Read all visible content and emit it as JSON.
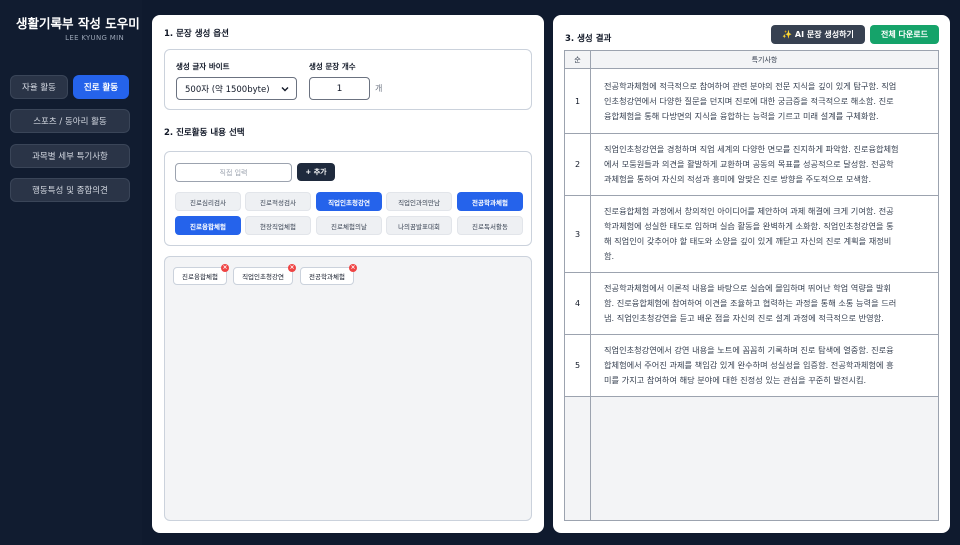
{
  "app": {
    "title": "생활기록부 작성 도우미",
    "author": "LEE KYUNG MIN"
  },
  "sidebar": {
    "tabs": [
      {
        "label": "자율 활동",
        "active": false
      },
      {
        "label": "진로 활동",
        "active": true
      }
    ],
    "items": [
      {
        "label": "스포츠 / 동아리 활동"
      },
      {
        "label": "과목별 세부 특기사항"
      },
      {
        "label": "행동특성 및 종합의견"
      }
    ]
  },
  "options": {
    "section_title": "1. 문장 생성 옵션",
    "byte_label": "생성 글자 바이트",
    "byte_value": "500자 (약 1500byte)",
    "count_label": "생성 문장 개수",
    "count_value": "1",
    "count_unit": "개"
  },
  "activity": {
    "section_title": "2. 진로활동 내용 선택",
    "input_placeholder": "직접 입력",
    "add_label": "+ 추가",
    "chips": [
      {
        "label": "진로심리검사",
        "selected": false
      },
      {
        "label": "진로적성검사",
        "selected": false
      },
      {
        "label": "직업인초청강연",
        "selected": true
      },
      {
        "label": "직업인과의만남",
        "selected": false
      },
      {
        "label": "전공학과체험",
        "selected": true
      },
      {
        "label": "진로융합체험",
        "selected": true
      },
      {
        "label": "현장직업체험",
        "selected": false
      },
      {
        "label": "진로체험의날",
        "selected": false
      },
      {
        "label": "나의꿈발표대회",
        "selected": false
      },
      {
        "label": "진로독서활동",
        "selected": false
      }
    ],
    "selected_items": [
      {
        "label": "진로융합체험"
      },
      {
        "label": "직업인초청강연"
      },
      {
        "label": "전공학과체험"
      }
    ],
    "remove_symbol": "×"
  },
  "results": {
    "section_title": "3. 생성 결과",
    "ai_button_label": "✨ AI 문장 생성하기",
    "download_label": "전체 다운로드",
    "col_num": "순",
    "col_text": "특기사항",
    "rows": [
      {
        "num": "1",
        "lines": [
          "전공학과체험에 적극적으로 참여하여 관련 분야의 전문 지식을 깊이 있게 탐구함. 직업",
          "인초청강연에서 다양한 질문을 던지며 진로에 대한 궁금증을 적극적으로 해소함. 진로",
          "융합체험을 통해 다방면의 지식을 융합하는 능력을 기르고 미래 설계를 구체화함."
        ]
      },
      {
        "num": "2",
        "lines": [
          "직업인초청강연을 경청하며 직업 세계의 다양한 면모를 진지하게 파악함. 진로융합체험",
          "에서 모둠원들과 의견을 활발하게 교환하며 공동의 목표를 성공적으로 달성함. 전공학",
          "과체험을 통하여 자신의 적성과 흥미에 알맞은 진로 방향을 주도적으로 모색함."
        ]
      },
      {
        "num": "3",
        "lines": [
          "진로융합체험 과정에서 창의적인 아이디어를 제안하여 과제 해결에 크게 기여함. 전공",
          "학과체험에 성실한 태도로 임하며 실습 활동을 완벽하게 소화함. 직업인초청강연을 통",
          "해 직업인이 갖추어야 할 태도와 소양을 깊이 있게 깨닫고 자신의 진로 계획을 재정비",
          "함."
        ]
      },
      {
        "num": "4",
        "lines": [
          "전공학과체험에서 이론적 내용을 바탕으로 실습에 몰입하며 뛰어난 학업 역량을 발휘",
          "함. 진로융합체험에 참여하여 이견을 조율하고 협력하는 과정을 통해 소통 능력을 드러",
          "냄. 직업인초청강연을 듣고 배운 점을 자신의 진로 설계 과정에 적극적으로 반영함."
        ]
      },
      {
        "num": "5",
        "lines": [
          "직업인초청강연에서 강연 내용을 노트에 꼼꼼히 기록하며 진로 탐색에 열중함. 진로융",
          "합체험에서 주어진 과제를 책임감 있게 완수하며 성실성을 입증함. 전공학과체험에 흥",
          "미를 가지고 참여하여 해당 분야에 대한 진정성 있는 관심을 꾸준히 발전시킴."
        ]
      }
    ]
  }
}
